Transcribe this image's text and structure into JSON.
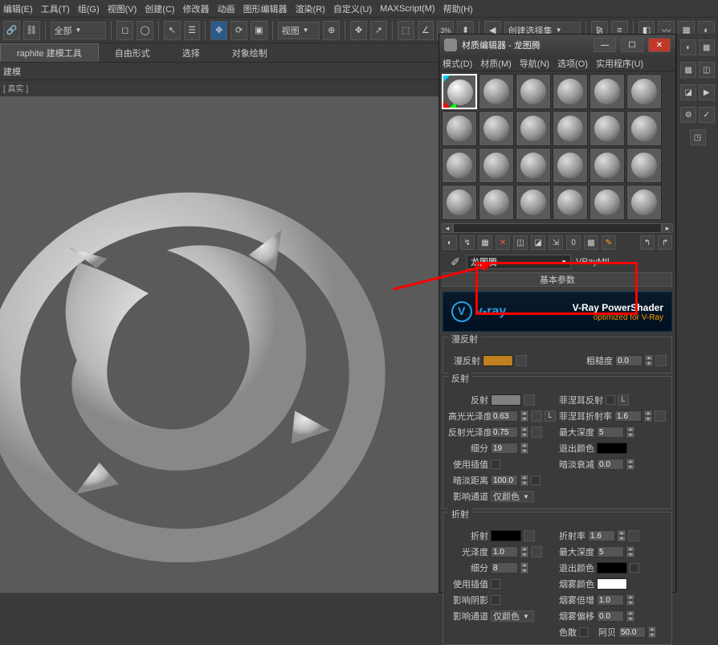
{
  "menus": [
    "编辑(E)",
    "工具(T)",
    "组(G)",
    "视图(V)",
    "创建(C)",
    "修改器",
    "动画",
    "图形编辑器",
    "渲染(R)",
    "自定义(U)",
    "MAXScript(M)",
    "帮助(H)"
  ],
  "toolbar": {
    "all_dropdown": "全部",
    "view_dropdown": "视图",
    "selection_set": "创建选择集"
  },
  "ribbon": {
    "tabs": [
      "raphite 建模工具",
      "自由形式",
      "选择",
      "对象绘制"
    ],
    "sub": "建模"
  },
  "scene_tab": "[ 真实 ]",
  "mat_editor": {
    "title": "材质编辑器 - 龙图腾",
    "menus": [
      "模式(D)",
      "材质(M)",
      "导航(N)",
      "选项(O)",
      "实用程序(U)"
    ],
    "material_name": "龙图腾",
    "material_type": "VRayMtl",
    "rollout_basic": "基本参数",
    "vray": {
      "brand": "v-ray",
      "line1": "V-Ray PowerShader",
      "line2": "optimized for V-Ray"
    },
    "diffuse": {
      "group": "漫反射",
      "diffuse_lbl": "漫反射",
      "roughness_lbl": "粗糙度",
      "roughness_val": "0.0"
    },
    "reflect": {
      "group": "反射",
      "reflect_lbl": "反射",
      "hilight_gloss_lbl": "高光光泽度",
      "hilight_gloss_val": "0.63",
      "reflect_gloss_lbl": "反射光泽度",
      "reflect_gloss_val": "0.75",
      "subdiv_lbl": "细分",
      "subdiv_val": "19",
      "use_interp_lbl": "使用插值",
      "dim_dist_lbl": "暗淡距离",
      "dim_dist_val": "100.0",
      "affect_lbl": "影响通道",
      "affect_val": "仅颜色",
      "fresnel_lbl": "菲涅耳反射",
      "fresnel_ior_lbl": "菲涅耳折射率",
      "fresnel_ior_val": "1.6",
      "max_depth_lbl": "最大深度",
      "max_depth_val": "5",
      "exit_color_lbl": "退出颜色",
      "dim_falloff_lbl": "暗淡衰减",
      "dim_falloff_val": "0.0",
      "L_btn": "L"
    },
    "refract": {
      "group": "折射",
      "refract_lbl": "折射",
      "gloss_lbl": "光泽度",
      "gloss_val": "1.0",
      "subdiv_lbl": "细分",
      "subdiv_val": "8",
      "use_interp_lbl": "使用插值",
      "affect_shadow_lbl": "影响阴影",
      "affect_lbl": "影响通道",
      "affect_val": "仅颜色",
      "ior_lbl": "折射率",
      "ior_val": "1.6",
      "max_depth_lbl": "最大深度",
      "max_depth_val": "5",
      "exit_color_lbl": "退出颜色",
      "fog_color_lbl": "烟雾颜色",
      "fog_mult_lbl": "烟雾倍增",
      "fog_mult_val": "1.0",
      "fog_bias_lbl": "烟雾偏移",
      "fog_bias_val": "0.0",
      "dispersion_lbl": "色散",
      "abbe_lbl": "阿贝",
      "abbe_val": "50.0"
    }
  }
}
